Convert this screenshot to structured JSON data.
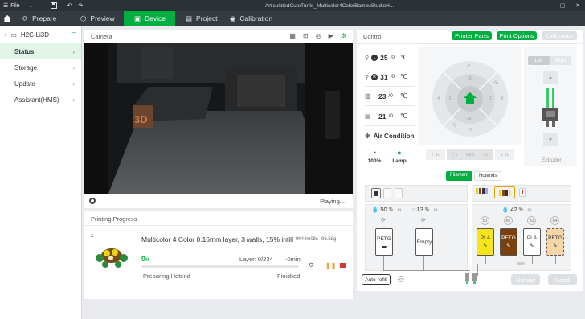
{
  "app": {
    "menu_label": "File",
    "title": "ArticulatedCuteTurtle_Multicolor4ColorBambuStudioH..."
  },
  "nav": {
    "tabs": [
      {
        "label": "Prepare"
      },
      {
        "label": "Preview"
      },
      {
        "label": "Device"
      },
      {
        "label": "Project"
      },
      {
        "label": "Calibration"
      }
    ]
  },
  "sidebar": {
    "device": "H2C-Li3D",
    "items": [
      {
        "label": "Status"
      },
      {
        "label": "Storage"
      },
      {
        "label": "Update"
      },
      {
        "label": "Assistant(HMS)"
      }
    ]
  },
  "camera": {
    "title": "Camera",
    "status": "Playing..."
  },
  "progress": {
    "title": "Printing Progress",
    "plate": "1",
    "job": "Multicolor 4 Color 0.16mm layer, 3 walls, 15% infill",
    "time": "9h44m08s",
    "weight": "96.59g",
    "percent": "0",
    "percent_unit": "%",
    "layer": "Layer: 0/234",
    "remaining": "-0min",
    "stage": "Preparing Hotend",
    "finish": "Finished",
    "fraction": 0.0
  },
  "control": {
    "title": "Control",
    "printer_parts": "Printer Parts",
    "print_options": "Print Options",
    "calibration": "Calibration",
    "temps": [
      {
        "value": "25",
        "target": "/0",
        "unit": "℃",
        "badge": "L"
      },
      {
        "value": "31",
        "target": "/0",
        "unit": "℃",
        "badge": "R"
      },
      {
        "value": "23",
        "target": "/0",
        "unit": "℃",
        "badge": ""
      },
      {
        "value": "21",
        "target": "/0",
        "unit": "℃",
        "badge": ""
      }
    ],
    "air": "Air Condition",
    "fan_value": "100%",
    "lamp": "Lamp",
    "jog": {
      "up": "Y",
      "down": "-Y",
      "left": "-X",
      "right": "X",
      "up_inner": "10",
      "down_inner": "-10",
      "left_inner": "-1",
      "right_inner": "1",
      "inner_up": "1",
      "inner_down": "-1",
      "inner_left": "-10",
      "inner_right": "10",
      "x_diag1": "10",
      "x_diag2": "-10"
    },
    "bed": {
      "up10": "10",
      "up1": "1",
      "label": "Bed",
      "down1": "1",
      "down10": "10"
    },
    "extruder": {
      "left": "Left",
      "right": "Right",
      "label": "Extruder"
    }
  },
  "filament": {
    "tab_filament": "Filament",
    "tab_hotends": "Hotends",
    "ams_left": {
      "humidity": "50",
      "humidity_unit": "%",
      "temp_label": "13",
      "temp_unit": "%",
      "slots": [
        {
          "label": "PETG",
          "color": "#ffffff"
        },
        {
          "label": "Empty",
          "color": "#ffffff"
        }
      ]
    },
    "ams_right": {
      "humidity": "42",
      "humidity_unit": "%",
      "slots": [
        {
          "label": "PLA",
          "color": "#f5e51a",
          "badge": "B1"
        },
        {
          "label": "PETG",
          "color": "#7a4010",
          "badge": "B2"
        },
        {
          "label": "PLA",
          "color": "#ffffff",
          "badge": "B3"
        },
        {
          "label": "PETG",
          "color": "#f6d6a8",
          "badge": "B4"
        }
      ]
    },
    "auto_refill": "Auto-refill",
    "unload": "Unload",
    "load": "Load"
  }
}
